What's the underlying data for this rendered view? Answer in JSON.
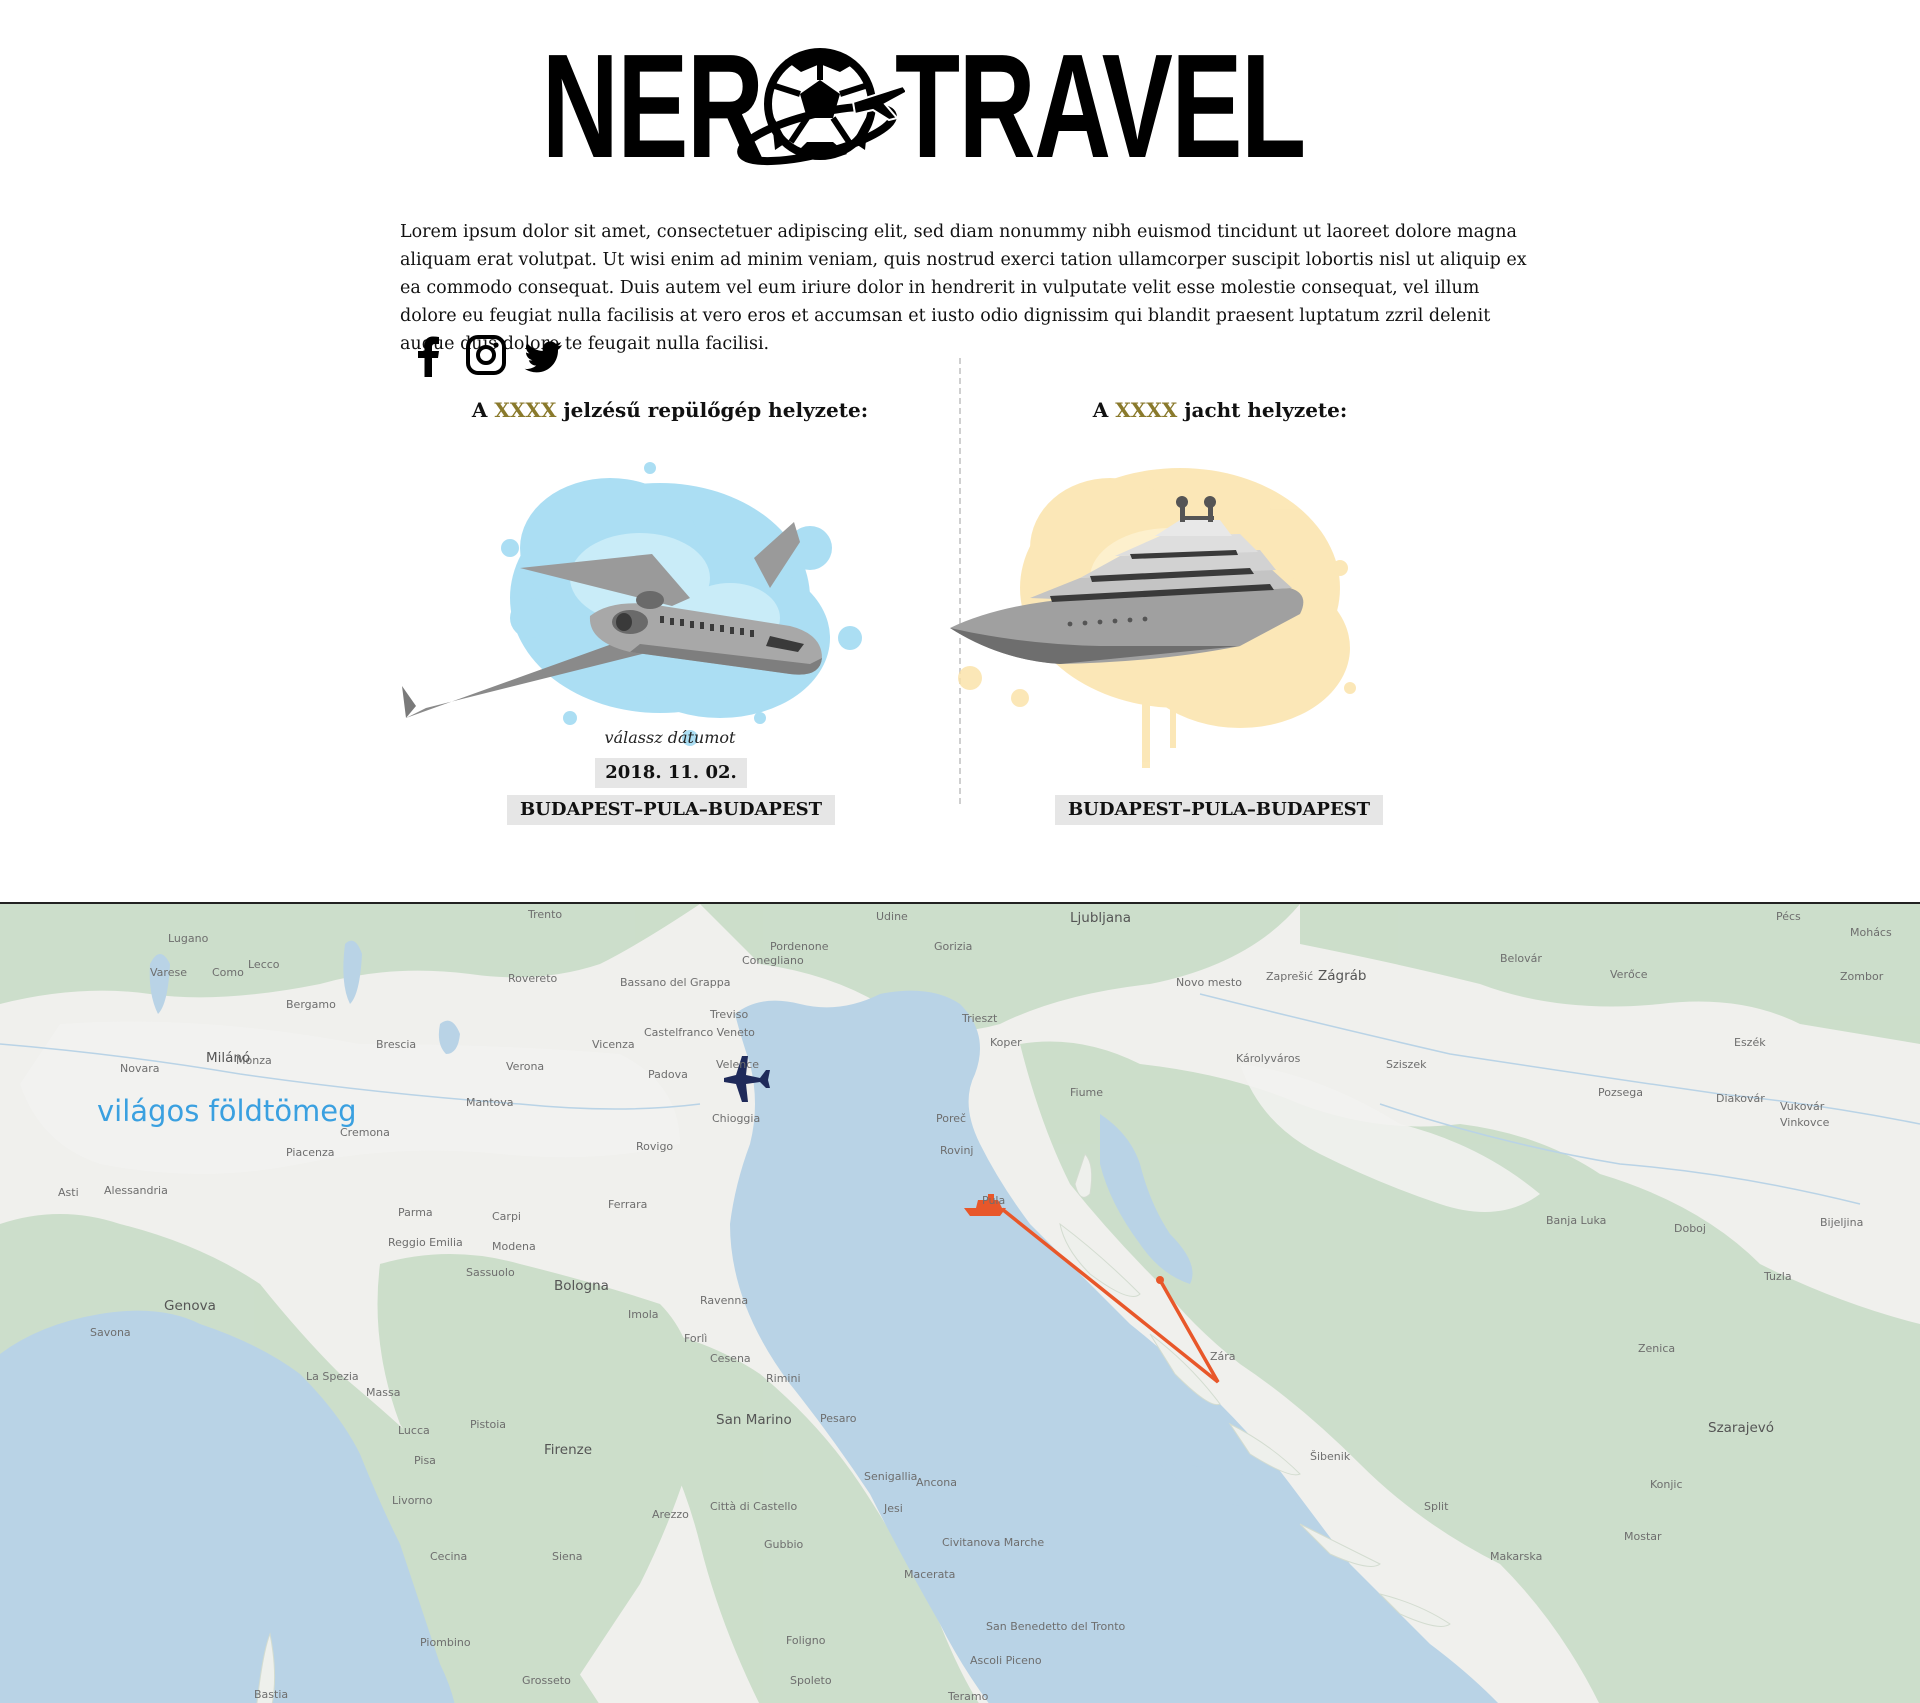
{
  "brand": {
    "left": "NER",
    "right": "TRAVEL"
  },
  "intro": "Lorem ipsum dolor sit amet, consectetuer adipiscing elit, sed diam nonummy nibh euismod tincidunt ut laoreet dolore magna aliquam erat volutpat. Ut wisi enim ad minim veniam, quis nostrud exerci tation ullamcorper suscipit lobortis nisl ut aliquip ex ea commodo consequat. Duis autem vel eum iriure dolor in hendrerit in vulputate velit esse molestie consequat, vel illum dolore eu feugiat nulla facilisis at vero eros et accumsan et iusto odio dignissim qui blandit praesent luptatum zzril delenit augue duis dolore te feugait nulla facilisi.",
  "social": [
    "facebook-icon",
    "instagram-icon",
    "twitter-icon"
  ],
  "plane": {
    "title_pre": "A ",
    "code": "XXXX",
    "title_post": " jelzésű repülőgép helyzete:",
    "date_label": "válassz dátumot",
    "date": "2018. 11. 02.",
    "route": "BUDAPEST–PULA–BUDAPEST",
    "splash_color": "#8fd3f0"
  },
  "yacht": {
    "title_pre": "A ",
    "code": "XXXX",
    "title_post": " jacht helyzete:",
    "route": "BUDAPEST–PULA–BUDAPEST",
    "splash_color": "#fbe2a6"
  },
  "map": {
    "label": "világos földtömeg",
    "route_color": "#e8572a",
    "plane_marker_color": "#1f2a5a",
    "cities": {
      "trento": "Trento",
      "udine": "Udine",
      "ljubljana": "Ljubljana",
      "pecs": "Pécs",
      "mohacs": "Mohács",
      "lugano": "Lugano",
      "pordenone": "Pordenone",
      "gorizia": "Gorizia",
      "como": "Como",
      "varese": "Varese",
      "lecco": "Lecco",
      "bergamo": "Bergamo",
      "brescia": "Brescia",
      "rovereto": "Rovereto",
      "bassano": "Bassano del Grappa",
      "conegliano": "Conegliano",
      "treviso": "Treviso",
      "trieszt": "Trieszt",
      "novo_mesto": "Novo mesto",
      "zapresic": "Zaprešić",
      "zagrab": "Zágráb",
      "belovar": "Belovár",
      "verőce": "Verőce",
      "zombor": "Zombor",
      "vicenza": "Vicenza",
      "castelfranco": "Castelfranco Veneto",
      "padova": "Padova",
      "velence": "Velence",
      "milano": "Milánó",
      "monza": "Monza",
      "novara": "Novara",
      "verona": "Verona",
      "chioggia": "Chioggia",
      "koper": "Koper",
      "fiume": "Fiume",
      "karolyvaros": "Károlyváros",
      "sziszek": "Sziszek",
      "eszek": "Eszék",
      "mantova": "Mantova",
      "cremona": "Cremona",
      "piacenza": "Piacenza",
      "rovigo": "Rovigo",
      "porec": "Poreč",
      "rovinj": "Rovinj",
      "pozsega": "Pozsega",
      "diakovar": "Diakovár",
      "vukovar": "Vukovár",
      "vinkovce": "Vinkovce",
      "alessandria": "Alessandria",
      "asti": "Asti",
      "ferrara": "Ferrara",
      "parma": "Parma",
      "carpi": "Carpi",
      "pula": "Pula",
      "banja_luka": "Banja Luka",
      "dobo": "Doboj",
      "bijeljina": "Bijeljina",
      "reggio": "Reggio Emilia",
      "modena": "Modena",
      "sassuolo": "Sassuolo",
      "bologna": "Bologna",
      "genova": "Genova",
      "savona": "Savona",
      "ravenna": "Ravenna",
      "imola": "Imola",
      "forli": "Forlì",
      "cesena": "Cesena",
      "rimini": "Rimini",
      "tuzla": "Tuzla",
      "zenica": "Zenica",
      "la_spezia": "La Spezia",
      "massa": "Massa",
      "lucca": "Lucca",
      "pistoia": "Pistoia",
      "san_marino": "San Marino",
      "pesaro": "Pesaro",
      "zara": "Zára",
      "szarajevo": "Szarajevó",
      "pisa": "Pisa",
      "firenze": "Firenze",
      "livorno": "Livorno",
      "sibenik": "Šibenik",
      "split": "Split",
      "senigallia": "Senigallia",
      "ancona": "Ancona",
      "arezzo": "Arezzo",
      "jesi": "Jesi",
      "citta": "Città di Castello",
      "gubbio": "Gubbio",
      "makarska": "Makarska",
      "mostar": "Mostar",
      "konjic": "Konjic",
      "civitanova": "Civitanova Marche",
      "macerata": "Macerata",
      "cecina": "Cecina",
      "siena": "Siena",
      "piombino": "Piombino",
      "grosseto": "Grosseto",
      "foligno": "Foligno",
      "spoleto": "Spoleto",
      "san_benedetto": "San Benedetto del Tronto",
      "ascoli": "Ascoli Piceno",
      "teramo": "Teramo",
      "bastia": "Bastia"
    }
  }
}
